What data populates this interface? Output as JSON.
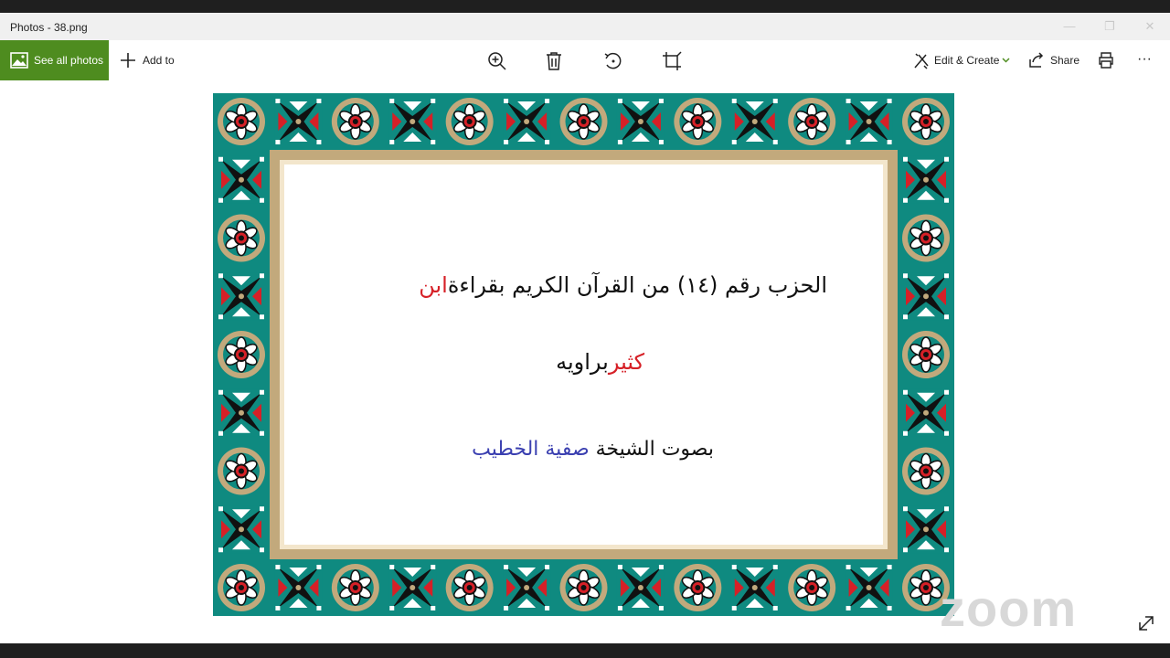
{
  "window": {
    "title": "Photos - 38.png",
    "controls": {
      "minimize": "—",
      "restore": "❐",
      "close": "✕"
    }
  },
  "toolbar": {
    "see_all_label": "See all photos",
    "add_to_label": "Add to",
    "icons": [
      "zoom-in-icon",
      "delete-icon",
      "rotate-icon",
      "crop-icon"
    ],
    "edit_create_label": "Edit & Create",
    "share_label": "Share",
    "more_label": "···"
  },
  "image": {
    "line1_black": "الحزب رقم (١٤) من القرآن الكريم بقراءة",
    "line1_red": "ابن",
    "line2_red": "كثير",
    "line2_black": "براويه",
    "line3_black": "بصوت الشيخة",
    "line3_blue": "صفية الخطيب"
  },
  "watermark": "zoom",
  "colors": {
    "accent": "#4e8c1f",
    "frame_teal": "#0f8a80",
    "frame_gold": "#c2a97c",
    "text_red": "#d62027",
    "text_blue": "#3a3fb0"
  }
}
